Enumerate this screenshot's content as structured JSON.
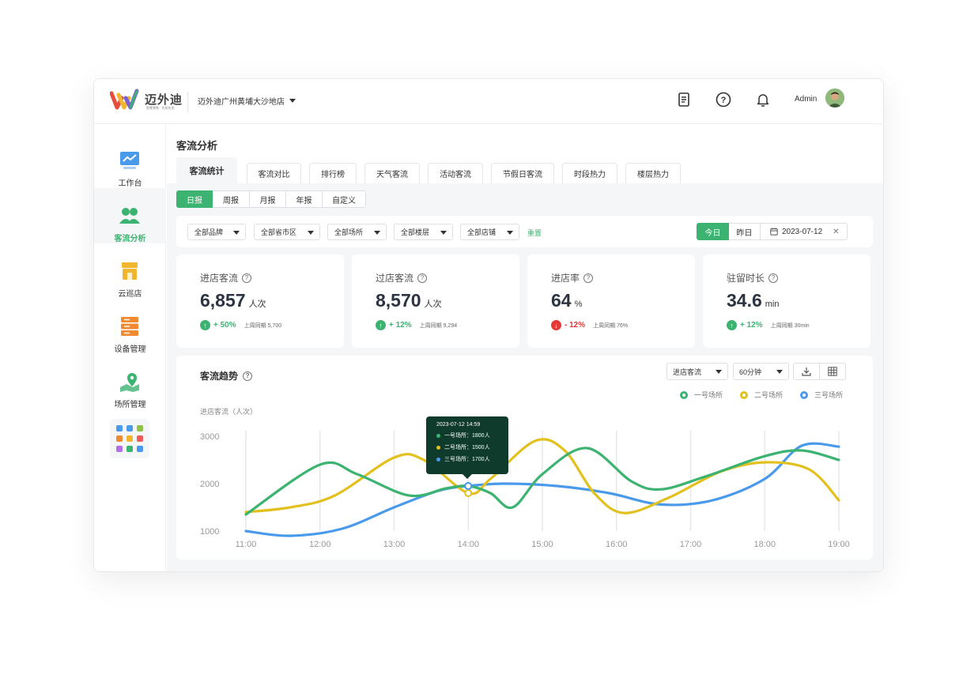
{
  "header": {
    "logo_text": "迈外迪",
    "logo_sub": "智慧零售 · 先知先觉",
    "store": "迈外迪广州黄埔大沙地店",
    "admin": "Admin"
  },
  "sidebar": {
    "items": [
      {
        "label": "工作台",
        "icon": "monitor-chart-icon"
      },
      {
        "label": "客流分析",
        "icon": "people-icon"
      },
      {
        "label": "云巡店",
        "icon": "store-icon"
      },
      {
        "label": "设备管理",
        "icon": "server-icon"
      },
      {
        "label": "场所管理",
        "icon": "location-icon"
      }
    ],
    "active": "客流分析"
  },
  "page": {
    "title": "客流分析",
    "tabs": [
      "客流统计",
      "客流对比",
      "排行榜",
      "天气客流",
      "活动客流",
      "节假日客流",
      "时段热力",
      "楼层热力"
    ],
    "periods": [
      "日报",
      "周报",
      "月报",
      "年报",
      "自定义"
    ]
  },
  "filters": {
    "selects": [
      "全部品牌",
      "全部省市区",
      "全部场所",
      "全部楼层",
      "全部店铺"
    ],
    "reset": "重置",
    "today": "今日",
    "yesterday": "昨日",
    "date": "2023-07-12"
  },
  "cards": [
    {
      "title": "进店客流",
      "value": "6,857",
      "unit": "人次",
      "change": "+ 50%",
      "trend": "up",
      "compare": "上周同期 5,700"
    },
    {
      "title": "过店客流",
      "value": "8,570",
      "unit": "人次",
      "change": "+ 12%",
      "trend": "up",
      "compare": "上周同期 9,294"
    },
    {
      "title": "进店率",
      "value": "64",
      "unit": "%",
      "change": "- 12%",
      "trend": "down",
      "compare": "上周同期 76%"
    },
    {
      "title": "驻留时长",
      "value": "34.6",
      "unit": "min",
      "change": "+ 12%",
      "trend": "up",
      "compare": "上周同期 30min"
    }
  ],
  "chart_panel": {
    "title": "客流趋势",
    "metric_select": "进店客流",
    "interval_select": "60分钟",
    "y_axis_label": "进店客流（人次）",
    "tooltip": {
      "time": "2023-07-12  14:59",
      "rows": [
        "一号场所：1800人",
        "二号场所：1500人",
        "三号场所：1700人"
      ]
    }
  },
  "colors": {
    "accent": "#3cb371",
    "series1": "#3cb371",
    "series2": "#e2c01e",
    "series3": "#4a9aeb",
    "danger": "#e53935"
  },
  "chart_data": {
    "type": "line",
    "x": [
      "11:00",
      "12:00",
      "13:00",
      "14:00",
      "15:00",
      "16:00",
      "17:00",
      "18:00",
      "19:00"
    ],
    "yticks": [
      1000,
      2000,
      3000
    ],
    "ylim": [
      800,
      3100
    ],
    "grid": "vertical",
    "legend": "top-right",
    "series": [
      {
        "name": "一号场所",
        "color": "#3cb371",
        "points": [
          [
            11.0,
            1350
          ],
          [
            12.0,
            2400
          ],
          [
            12.5,
            2200
          ],
          [
            13.2,
            1750
          ],
          [
            13.7,
            1900
          ],
          [
            14.0,
            1950
          ],
          [
            14.3,
            1800
          ],
          [
            14.6,
            1500
          ],
          [
            15.0,
            2200
          ],
          [
            15.6,
            2750
          ],
          [
            16.2,
            2050
          ],
          [
            16.6,
            1880
          ],
          [
            17.2,
            2150
          ],
          [
            18.0,
            2580
          ],
          [
            18.5,
            2700
          ],
          [
            19.0,
            2500
          ]
        ]
      },
      {
        "name": "二号场所",
        "color": "#e2c01e",
        "points": [
          [
            11.0,
            1400
          ],
          [
            11.6,
            1500
          ],
          [
            12.2,
            1750
          ],
          [
            13.0,
            2550
          ],
          [
            13.4,
            2500
          ],
          [
            14.0,
            1800
          ],
          [
            14.3,
            2100
          ],
          [
            14.9,
            2900
          ],
          [
            15.3,
            2700
          ],
          [
            15.7,
            1800
          ],
          [
            16.1,
            1380
          ],
          [
            16.7,
            1700
          ],
          [
            17.4,
            2250
          ],
          [
            18.0,
            2450
          ],
          [
            18.6,
            2300
          ],
          [
            19.0,
            1650
          ]
        ]
      },
      {
        "name": "三号场所",
        "color": "#4a9aeb",
        "points": [
          [
            11.0,
            1000
          ],
          [
            11.6,
            900
          ],
          [
            12.3,
            1050
          ],
          [
            13.0,
            1500
          ],
          [
            13.6,
            1850
          ],
          [
            14.0,
            1950
          ],
          [
            14.5,
            2000
          ],
          [
            15.2,
            1950
          ],
          [
            15.9,
            1800
          ],
          [
            16.6,
            1560
          ],
          [
            17.3,
            1650
          ],
          [
            18.0,
            2100
          ],
          [
            18.5,
            2800
          ],
          [
            19.0,
            2780
          ]
        ]
      }
    ]
  }
}
